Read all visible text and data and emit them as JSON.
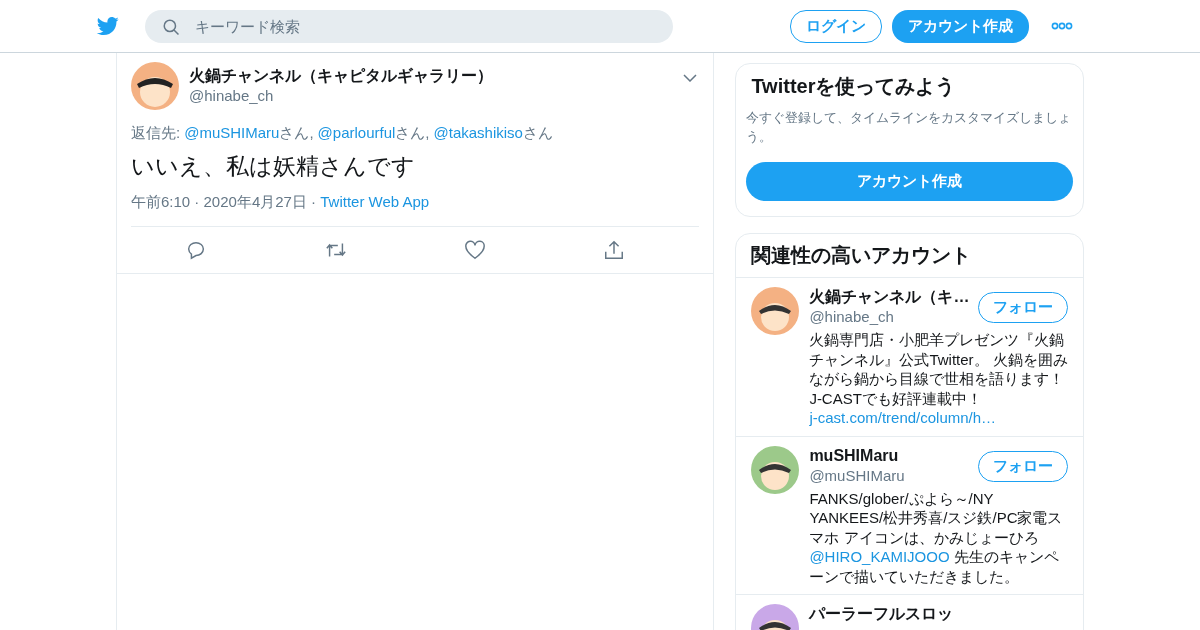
{
  "header": {
    "search": {
      "placeholder": "キーワード検索"
    },
    "login": "ログイン",
    "signup": "アカウント作成"
  },
  "tweet": {
    "name": "火鍋チャンネル（キャピタルギャラリー）",
    "handle": "@hinabe_ch",
    "reply_label": "返信先:",
    "mentions": [
      {
        "handle": "@muSHIMaru",
        "suffix": "さん,"
      },
      {
        "handle": "@parlourful",
        "suffix": "さん,"
      },
      {
        "handle": "@takashikiso",
        "suffix": "さん"
      }
    ],
    "text": "いいえ、私は妖精さんです",
    "time": "午前6:10 · 2020年4月27日 ·",
    "source": "Twitter Web App"
  },
  "signup_card": {
    "title": "Twitterを使ってみよう",
    "text": "今すぐ登録して、タイムラインをカスタマイズしましょう。",
    "button": "アカウント作成"
  },
  "related": {
    "title": "関連性の高いアカウント",
    "accounts": [
      {
        "name": "火鍋チャンネル（キ…",
        "handle": "@hinabe_ch",
        "follow": "フォロー",
        "bio": [
          {
            "kind": "text",
            "text": "火鍋専門店・小肥羊プレゼンツ『火鍋チャンネル』公式Twitter。 火鍋を囲みながら鍋から目線で世相を語ります！J-CASTでも好評連載中！ "
          },
          {
            "kind": "link",
            "text": "j-cast.com/trend/column/h…"
          }
        ]
      },
      {
        "name": "muSHIMaru",
        "handle": "@muSHIMaru",
        "follow": "フォロー",
        "bio": [
          {
            "kind": "text",
            "text": "FANKS/glober/ぷよら～/NY YANKEES/松井秀喜/スジ鉄/PC家電スマホ アイコンは、かみじょーひろ "
          },
          {
            "kind": "link",
            "text": "@HIRO_KAMIJOOO"
          },
          {
            "kind": "text",
            "text": " 先生のキャンペーンで描いていただきました。"
          }
        ]
      },
      {
        "name": "パーラーフルスロッ"
      }
    ]
  }
}
